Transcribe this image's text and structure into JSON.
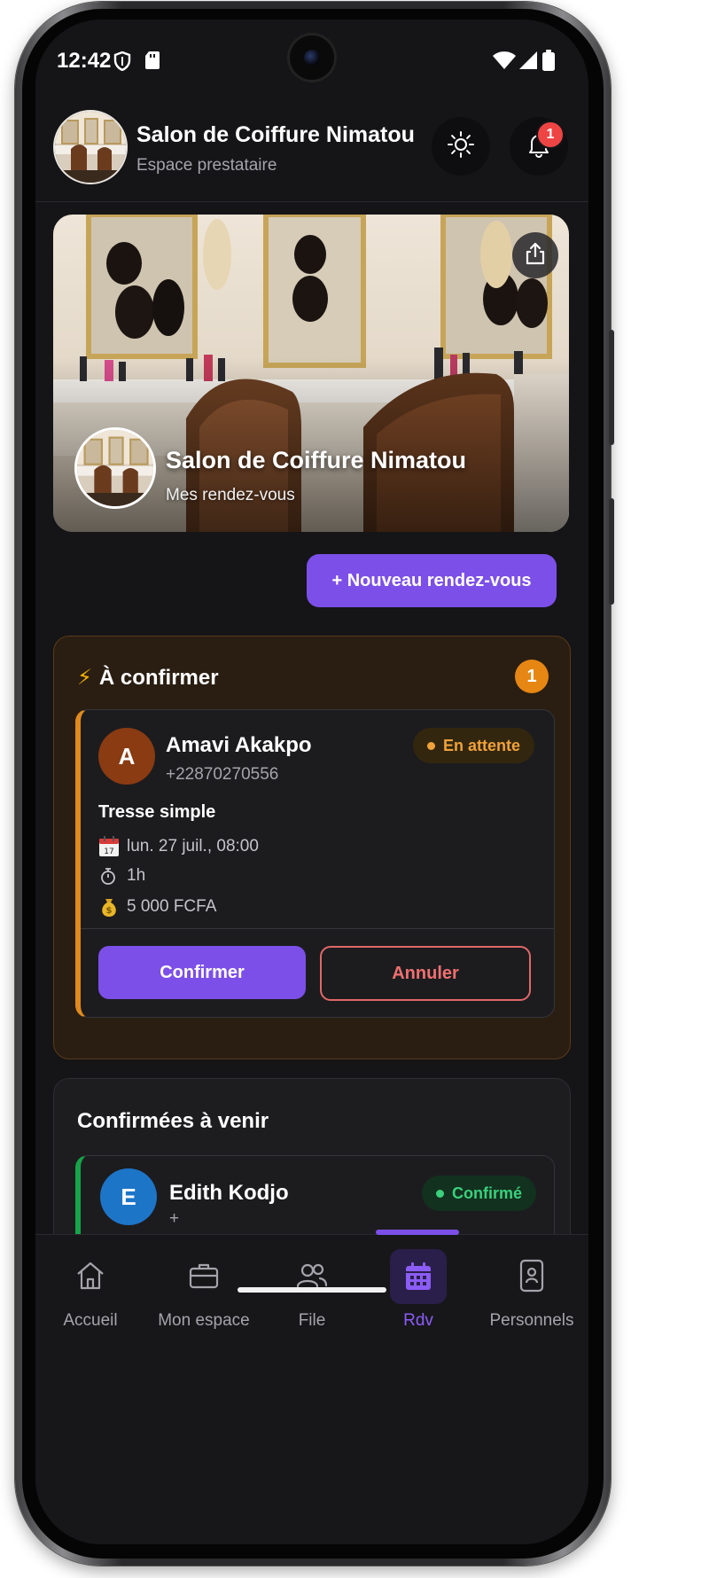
{
  "status_bar": {
    "time": "12:42"
  },
  "header": {
    "salon_name": "Salon de Coiffure Nimatou",
    "subtitle": "Espace prestataire",
    "notification_count": "1"
  },
  "hero": {
    "title": "Salon de Coiffure Nimatou",
    "subtitle": "Mes rendez-vous"
  },
  "actions": {
    "new_appointment": "+ Nouveau rendez-vous"
  },
  "pending_section": {
    "icon": "⚡",
    "title": "À confirmer",
    "count": "1",
    "appointment": {
      "initial": "A",
      "name": "Amavi Akakpo",
      "phone": "+22870270556",
      "status": "En attente",
      "service": "Tresse simple",
      "date": "lun. 27 juil., 08:00",
      "duration": "1h",
      "price": "5 000 FCFA",
      "confirm_label": "Confirmer",
      "cancel_label": "Annuler"
    }
  },
  "confirmed_section": {
    "title": "Confirmées à venir",
    "appointment": {
      "initial": "E",
      "name": "Edith Kodjo",
      "phone": "+",
      "status": "Confirmé"
    }
  },
  "bottom_nav": {
    "items": [
      {
        "label": "Accueil",
        "icon": "home-icon"
      },
      {
        "label": "Mon espace",
        "icon": "briefcase-icon"
      },
      {
        "label": "File",
        "icon": "users-icon"
      },
      {
        "label": "Rdv",
        "icon": "calendar-icon"
      },
      {
        "label": "Personnels",
        "icon": "phone-badge-icon"
      }
    ],
    "active_index": 3
  },
  "colors": {
    "accent": "#7c4fe8",
    "pending": "#e68613",
    "confirmed": "#16a34a",
    "danger": "#e06868"
  }
}
